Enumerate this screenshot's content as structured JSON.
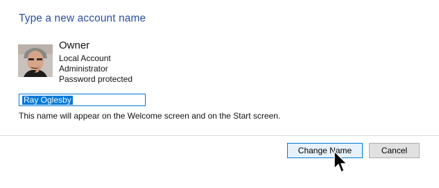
{
  "dialog": {
    "heading": "Type a new account name"
  },
  "account": {
    "name": "Owner",
    "details": [
      "Local Account",
      "Administrator",
      "Password protected"
    ]
  },
  "name_field": {
    "value": "Ray Oglesby",
    "selected": true
  },
  "hint_text": "This name will appear on the Welcome screen and on the Start screen.",
  "buttons": {
    "change_name": "Change Name",
    "cancel": "Cancel"
  },
  "colors": {
    "heading": "#2a4fa3",
    "accent": "#0078d7"
  },
  "icons": {
    "cursor": "arrow-cursor-icon",
    "avatar": "user-photo"
  }
}
